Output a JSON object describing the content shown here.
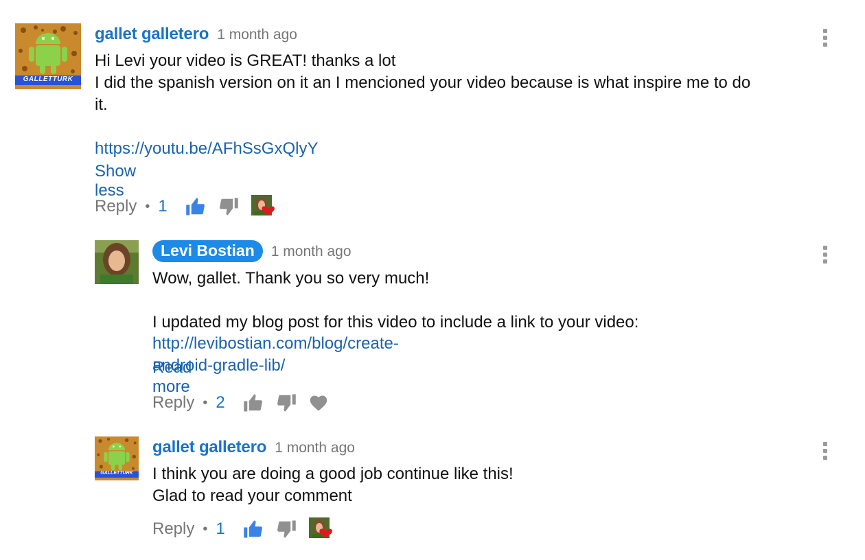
{
  "comments": [
    {
      "author": "gallet galletero",
      "time": "1 month ago",
      "lines": [
        "Hi Levi your video is GREAT! thanks a lot",
        "I did the spanish version on it an I mencioned your video because is what inspire me to do",
        "it."
      ],
      "link": "https://youtu.be/AFhSsGxQlyY",
      "toggle": "Show less",
      "reply_label": "Reply",
      "likes": "1",
      "liked": true,
      "hearted_by_creator": true,
      "avatar_icon": "android-logo-avatar",
      "avatar_text": "GALLETTURK"
    },
    {
      "author": "Levi Bostian",
      "time": "1 month ago",
      "lines": [
        "Wow, gallet. Thank you so very much!",
        "",
        "I updated my blog post for this video to include a link to your video:"
      ],
      "link": "http://levibostian.com/blog/create-android-gradle-lib/",
      "toggle": "Read more",
      "reply_label": "Reply",
      "likes": "2",
      "liked": false,
      "hearted_by_creator": false,
      "avatar_icon": "person-photo-avatar"
    },
    {
      "author": "gallet galletero",
      "time": "1 month ago",
      "lines": [
        "I think you are doing a good job continue like this!",
        "Glad to read your comment"
      ],
      "reply_label": "Reply",
      "likes": "1",
      "liked": true,
      "hearted_by_creator": true,
      "avatar_icon": "android-logo-avatar",
      "avatar_text": "GALLETTURK"
    }
  ],
  "colors": {
    "author_link": "#1a73c8",
    "creator_badge": "#1d8ae8",
    "thumb_active": "#3b82e8",
    "thumb_inactive": "#909090",
    "heart": "#e0181f"
  },
  "dot": "•"
}
